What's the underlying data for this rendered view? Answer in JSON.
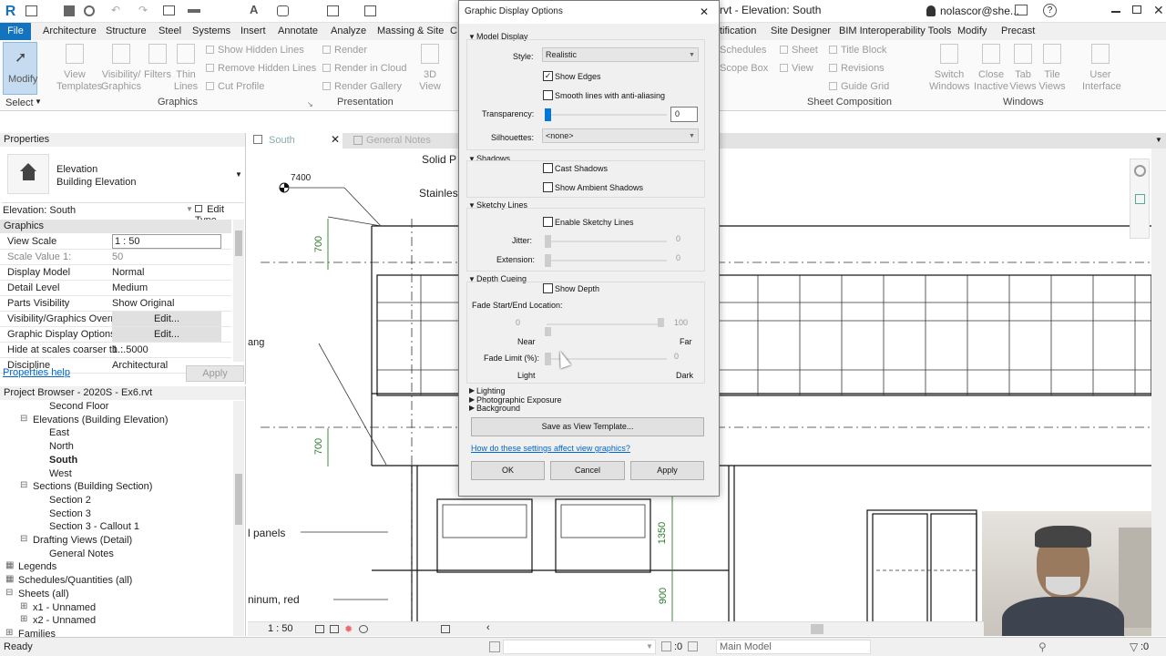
{
  "titlebar": {
    "title": "rvt - Elevation: South",
    "user": "nolascor@she..."
  },
  "menu_tabs": [
    "File",
    "Architecture",
    "Structure",
    "Steel",
    "Systems",
    "Insert",
    "Annotate",
    "Analyze",
    "Massing & Site",
    "C",
    "tification",
    "Site Designer",
    "BIM Interoperability Tools",
    "Modify",
    "Precast"
  ],
  "ribbon": {
    "modify": "Modify",
    "select": "Select",
    "view_templates": "View Templates",
    "visibility_graphics": "Visibility/ Graphics",
    "filters": "Filters",
    "thin_lines": "Thin Lines",
    "show_hidden_lines": "Show Hidden Lines",
    "remove_hidden_lines": "Remove Hidden Lines",
    "cut_profile": "Cut Profile",
    "render": "Render",
    "render_in_cloud": "Render in Cloud",
    "render_gallery": "Render Gallery",
    "view_3d": "3D View",
    "schedules": "Schedules",
    "scope_box": "Scope Box",
    "sheet": "Sheet",
    "title_block": "Title Block",
    "view": "View",
    "revisions": "Revisions",
    "guide_grid": "Guide Grid",
    "switch_windows": "Switch Windows",
    "close_inactive": "Close Inactive",
    "tab_views": "Tab Views",
    "tile_views": "Tile Views",
    "user_interface": "User Interface",
    "panel_graphics": "Graphics",
    "panel_presentation": "Presentation",
    "panel_sheet_composition": "Sheet Composition",
    "panel_windows": "Windows"
  },
  "properties": {
    "title": "Properties",
    "type_line1": "Elevation",
    "type_line2": "Building Elevation",
    "instance_selector": "Elevation: South",
    "edit_type": "Edit Type",
    "group_graphics": "Graphics",
    "rows": [
      {
        "k": "View Scale",
        "v": "1 : 50"
      },
      {
        "k": "Scale Value    1:",
        "v": "50"
      },
      {
        "k": "Display Model",
        "v": "Normal"
      },
      {
        "k": "Detail Level",
        "v": "Medium"
      },
      {
        "k": "Parts Visibility",
        "v": "Show Original"
      },
      {
        "k": "Visibility/Graphics Overr...",
        "v": "Edit..."
      },
      {
        "k": "Graphic Display Options",
        "v": "Edit..."
      },
      {
        "k": "Hide at scales coarser th...",
        "v": "1 : 5000"
      },
      {
        "k": "Discipline",
        "v": "Architectural"
      }
    ],
    "help": "Properties help",
    "apply": "Apply"
  },
  "browser": {
    "title": "Project Browser - 2020S - Ex6.rvt",
    "items": [
      {
        "label": "Second Floor",
        "indent": 3
      },
      {
        "label": "Elevations (Building Elevation)",
        "indent": 2
      },
      {
        "label": "East",
        "indent": 3
      },
      {
        "label": "North",
        "indent": 3
      },
      {
        "label": "South",
        "indent": 3,
        "bold": true
      },
      {
        "label": "West",
        "indent": 3
      },
      {
        "label": "Sections (Building Section)",
        "indent": 2
      },
      {
        "label": "Section 2",
        "indent": 3
      },
      {
        "label": "Section 3",
        "indent": 3
      },
      {
        "label": "Section 3 - Callout 1",
        "indent": 3
      },
      {
        "label": "Drafting Views (Detail)",
        "indent": 2
      },
      {
        "label": "General Notes",
        "indent": 3
      },
      {
        "label": "Legends",
        "indent": 1
      },
      {
        "label": "Schedules/Quantities (all)",
        "indent": 1
      },
      {
        "label": "Sheets (all)",
        "indent": 1
      },
      {
        "label": "x1 - Unnamed",
        "indent": 2
      },
      {
        "label": "x2 - Unnamed",
        "indent": 2
      },
      {
        "label": "Families",
        "indent": 1
      }
    ]
  },
  "viewtabs": {
    "active": "South",
    "inactive": "General Notes"
  },
  "drawing": {
    "level": "7400",
    "solid": "Solid P",
    "stainless": "Stainles",
    "dim1": "700",
    "dim2": "700",
    "dim3": "1350",
    "dim4": "900",
    "tag_ang": "ang",
    "tag_panels": "l panels",
    "tag_aluminum": "ninum, red"
  },
  "view_control": {
    "scale": "1 : 50"
  },
  "status": {
    "left": "Ready",
    "zero": ":0",
    "model": "Main Model"
  },
  "dialog": {
    "title": "Graphic Display Options",
    "model_display": "Model Display",
    "style_label": "Style:",
    "style_value": "Realistic",
    "show_edges": "Show Edges",
    "smooth_lines": "Smooth lines with anti-aliasing",
    "transparency_label": "Transparency:",
    "transparency_value": "0",
    "silhouettes_label": "Silhouettes:",
    "silhouettes_value": "<none>",
    "shadows": "Shadows",
    "cast_shadows": "Cast Shadows",
    "ambient_shadows": "Show Ambient Shadows",
    "sketchy_lines": "Sketchy Lines",
    "enable_sketchy": "Enable Sketchy Lines",
    "jitter_label": "Jitter:",
    "jitter_value": "0",
    "extension_label": "Extension:",
    "extension_value": "0",
    "depth_cueing": "Depth Cueing",
    "show_depth": "Show Depth",
    "fade_location": "Fade Start/End Location:",
    "fade_start": "0",
    "fade_end": "100",
    "near": "Near",
    "far": "Far",
    "fade_limit_label": "Fade Limit (%):",
    "fade_limit_value": "0",
    "light": "Light",
    "dark": "Dark",
    "lighting": "Lighting",
    "photographic_exposure": "Photographic Exposure",
    "background": "Background",
    "save_template": "Save as View Template...",
    "help_link": "How do these settings affect view graphics?",
    "ok": "OK",
    "cancel": "Cancel",
    "apply": "Apply",
    "show_edges_checked": true,
    "transparency_percent": 0
  },
  "colors": {
    "accent": "#1473bf",
    "slider": "#0078d7",
    "link": "#0066cc",
    "dim_green": "#2d7a2d"
  }
}
